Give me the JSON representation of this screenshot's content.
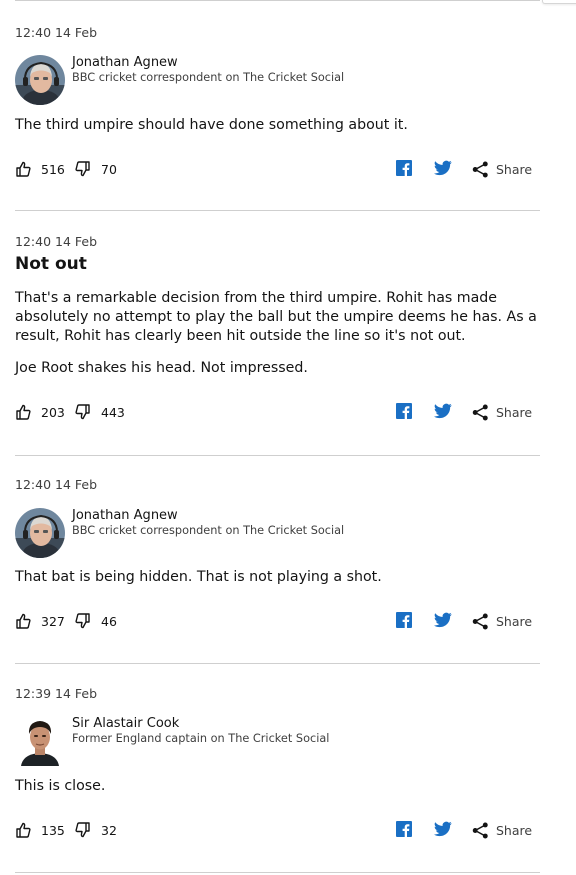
{
  "posts": [
    {
      "time": "12:40 14 Feb",
      "author": {
        "name": "Jonathan Agnew",
        "role": "BBC cricket correspondent on The Cricket Social",
        "avatar_icon": "person-photo-icon"
      },
      "headline": "",
      "paragraphs": [
        "The third umpire should have done something about it."
      ],
      "likes": "516",
      "dislikes": "70",
      "share_label": "Share"
    },
    {
      "time": "12:40 14 Feb",
      "author": null,
      "headline": "Not out",
      "paragraphs": [
        "That's a remarkable decision from the third umpire. Rohit has made absolutely no attempt to play the ball but the umpire deems he has. As a result, Rohit has clearly been hit outside the line so it's not out.",
        "Joe Root shakes his head. Not impressed."
      ],
      "likes": "203",
      "dislikes": "443",
      "share_label": "Share"
    },
    {
      "time": "12:40 14 Feb",
      "author": {
        "name": "Jonathan Agnew",
        "role": "BBC cricket correspondent on The Cricket Social",
        "avatar_icon": "person-photo-icon"
      },
      "headline": "",
      "paragraphs": [
        "That bat is being hidden. That is not playing a shot."
      ],
      "likes": "327",
      "dislikes": "46",
      "share_label": "Share"
    },
    {
      "time": "12:39 14 Feb",
      "author": {
        "name": "Sir Alastair Cook",
        "role": "Former England captain on The Cricket Social",
        "avatar_icon": "person-photo-icon"
      },
      "headline": "",
      "paragraphs": [
        "This is close."
      ],
      "likes": "135",
      "dislikes": "32",
      "share_label": "Share"
    }
  ],
  "icons": {
    "like": "thumbs-up-icon",
    "dislike": "thumbs-down-icon",
    "facebook": "facebook-icon",
    "twitter": "twitter-icon",
    "share": "share-icon"
  },
  "colors": {
    "brand_blue": "#1a6fc4",
    "text": "#141414",
    "divider": "#cfcfcf"
  }
}
